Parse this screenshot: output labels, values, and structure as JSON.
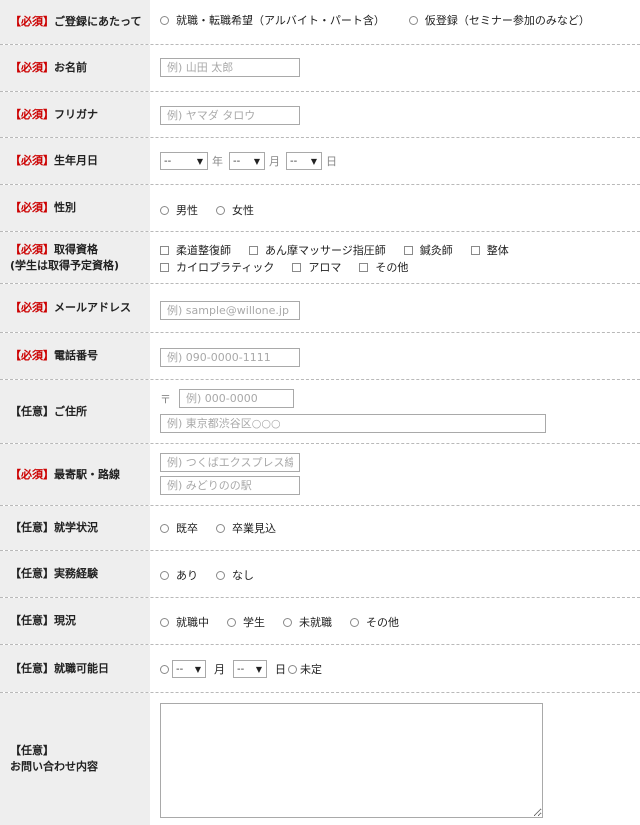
{
  "registration": {
    "tag": "【必須】",
    "label": "ご登録にあたって",
    "options": [
      "就職・転職希望（アルバイト・パート含）",
      "仮登録（セミナー参加のみなど）"
    ]
  },
  "name": {
    "tag": "【必須】",
    "label": "お名前",
    "placeholder": "例) 山田 太郎"
  },
  "furigana": {
    "tag": "【必須】",
    "label": "フリガナ",
    "placeholder": "例) ヤマダ タロウ"
  },
  "birthdate": {
    "tag": "【必須】",
    "label": "生年月日",
    "year_value": "--",
    "month_value": "--",
    "day_value": "--",
    "year_unit": "年",
    "month_unit": "月",
    "day_unit": "日"
  },
  "gender": {
    "tag": "【必須】",
    "label": "性別",
    "options": [
      "男性",
      "女性"
    ]
  },
  "qualification": {
    "tag": "【必須】",
    "label": "取得資格",
    "label2": "(学生は取得予定資格)",
    "options_row1": [
      "柔道整復師",
      "あん摩マッサージ指圧師",
      "鍼灸師",
      "整体"
    ],
    "options_row2": [
      "カイロプラティック",
      "アロマ",
      "その他"
    ]
  },
  "email": {
    "tag": "【必須】",
    "label": "メールアドレス",
    "placeholder": "例) sample@willone.jp"
  },
  "phone": {
    "tag": "【必須】",
    "label": "電話番号",
    "placeholder": "例) 090-0000-1111"
  },
  "address": {
    "tag": "【任意】",
    "label": "ご住所",
    "postal_mark": "〒",
    "zip_placeholder": "例) 000-0000",
    "address_placeholder": "例) 東京都渋谷区○○○"
  },
  "station": {
    "tag": "【必須】",
    "label": "最寄駅・路線",
    "line_placeholder": "例) つくばエクスプレス線",
    "station_placeholder": "例) みどりのの駅"
  },
  "school_status": {
    "tag": "【任意】",
    "label": "就学状況",
    "options": [
      "既卒",
      "卒業見込"
    ]
  },
  "experience": {
    "tag": "【任意】",
    "label": "実務経験",
    "options": [
      "あり",
      "なし"
    ]
  },
  "current_status": {
    "tag": "【任意】",
    "label": "現況",
    "options": [
      "就職中",
      "学生",
      "未就職",
      "その他"
    ]
  },
  "available_date": {
    "tag": "【任意】",
    "label": "就職可能日",
    "month_value": "--",
    "day_value": "--",
    "month_unit": "月",
    "day_unit": "日",
    "undecided": "未定"
  },
  "inquiry": {
    "tag": "【任意】",
    "label": "お問い合わせ内容"
  }
}
